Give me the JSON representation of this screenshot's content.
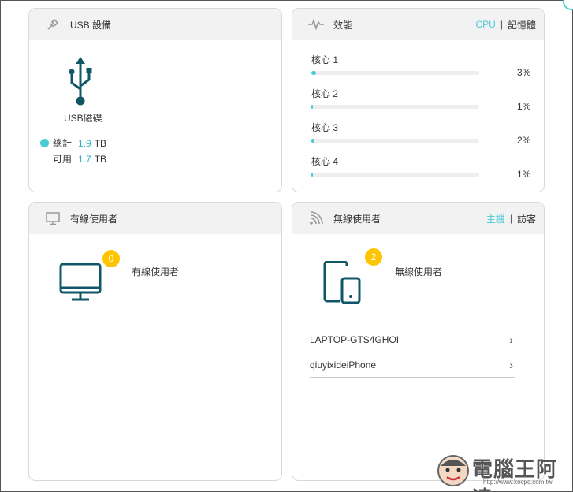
{
  "usb": {
    "title": "USB 設備",
    "disk_label": "USB磁碟",
    "total_label": "總計",
    "total_value": "1.9",
    "total_unit": "TB",
    "avail_label": "可用",
    "avail_value": "1.7",
    "avail_unit": "TB",
    "icons": {
      "header": "usb-plug-icon",
      "disk": "usb-symbol-icon"
    }
  },
  "performance": {
    "title": "效能",
    "tab_cpu": "CPU",
    "tab_separator": "|",
    "tab_memory": "記憶體",
    "icons": {
      "header": "pulse-icon"
    },
    "cores": [
      {
        "name": "核心 1",
        "percent_label": "3%",
        "percent": 3
      },
      {
        "name": "核心 2",
        "percent_label": "1%",
        "percent": 1
      },
      {
        "name": "核心 3",
        "percent_label": "2%",
        "percent": 2
      },
      {
        "name": "核心 4",
        "percent_label": "1%",
        "percent": 1
      }
    ]
  },
  "wired": {
    "title": "有線使用者",
    "count": "0",
    "label": "有線使用者",
    "icons": {
      "header": "monitor-icon",
      "main": "desktop-computer-icon"
    }
  },
  "wireless": {
    "title": "無線使用者",
    "tab_host": "主機",
    "tab_separator": "|",
    "tab_guest": "訪客",
    "count": "2",
    "label": "無線使用者",
    "icons": {
      "header": "wifi-signal-icon",
      "main": "tablet-phone-icon"
    },
    "devices": [
      {
        "name": "LAPTOP-GTS4GHOI"
      },
      {
        "name": "qiuyixideiPhone"
      }
    ]
  },
  "watermark": {
    "text": "電腦王阿達",
    "url": "http://www.kocpc.com.tw"
  },
  "colors": {
    "accent": "#4acbd6",
    "accent_text": "#2ab2bf",
    "badge": "#ffc400",
    "icon_dark": "#0f5766",
    "header_bg": "#f2f2f2"
  }
}
